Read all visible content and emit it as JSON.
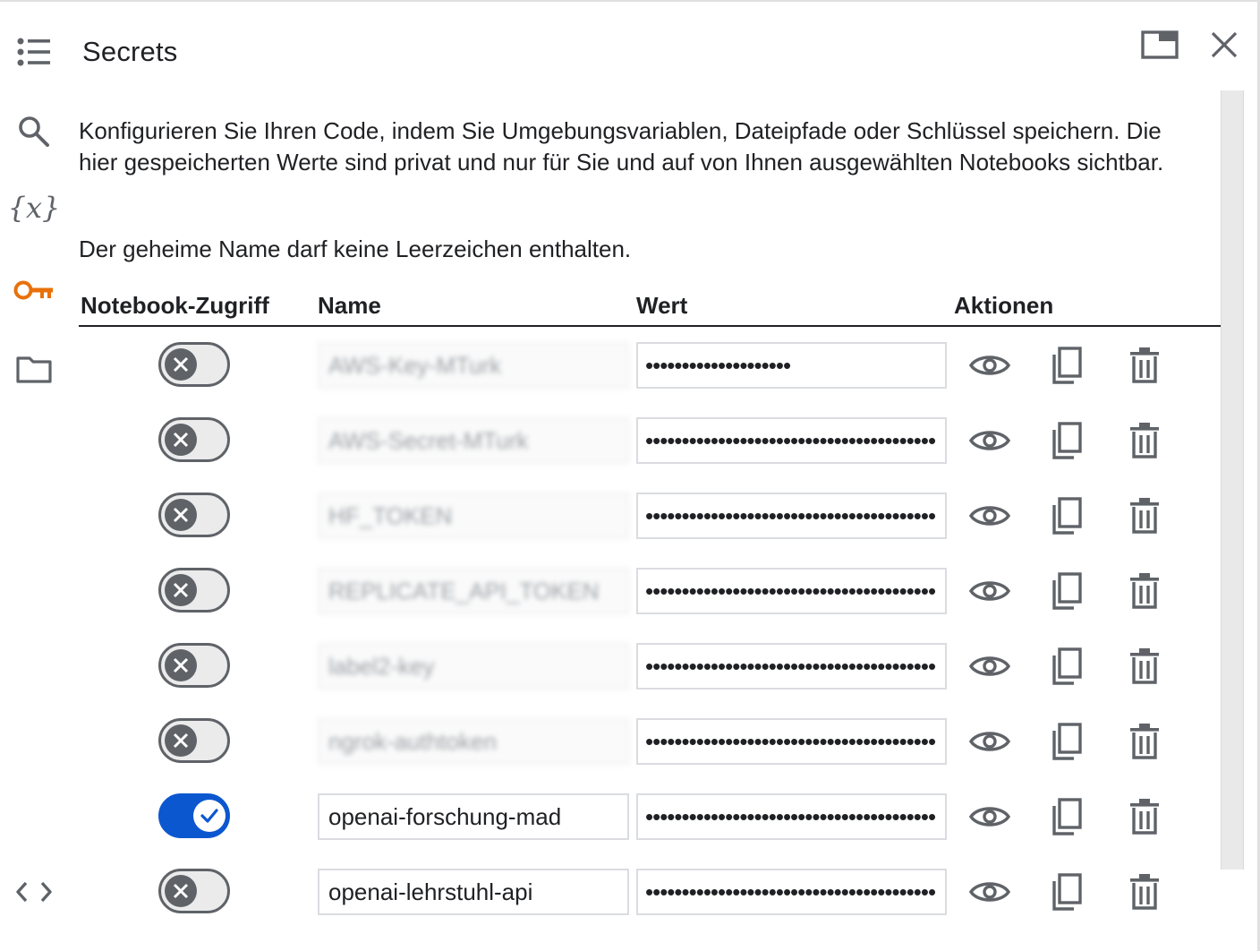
{
  "panel": {
    "title": "Secrets",
    "description": "Konfigurieren Sie Ihren Code, indem Sie Umgebungsvariablen, Dateipfade oder Schlüssel speichern. Die hier gespeicherten Werte sind privat und nur für Sie und auf von Ihnen ausgewählten Notebooks sichtbar.",
    "note": "Der geheime Name darf keine Leerzeichen enthalten."
  },
  "sidebar": {
    "items": [
      {
        "icon": "table-of-contents-icon"
      },
      {
        "icon": "search-icon"
      },
      {
        "icon": "variables-icon",
        "label": "{x}"
      },
      {
        "icon": "key-icon",
        "active": true,
        "color": "#e8710a"
      },
      {
        "icon": "folder-icon"
      },
      {
        "icon": "code-snippets-icon"
      }
    ]
  },
  "header_actions": [
    {
      "icon": "open-in-tab-icon"
    },
    {
      "icon": "close-icon"
    }
  ],
  "table": {
    "columns": [
      "Notebook-Zugriff",
      "Name",
      "Wert",
      "Aktionen"
    ],
    "rows": [
      {
        "access": false,
        "name": "AWS-Key-MTurk",
        "blurred": true,
        "value": "••••••••••••••••••••"
      },
      {
        "access": false,
        "name": "AWS-Secret-MTurk",
        "blurred": true,
        "value": "••••••••••••••••••••••••••••••••••••••••"
      },
      {
        "access": false,
        "name": "HF_TOKEN",
        "blurred": true,
        "value": "••••••••••••••••••••••••••••••••••••••••"
      },
      {
        "access": false,
        "name": "REPLICATE_API_TOKEN",
        "blurred": true,
        "value": "••••••••••••••••••••••••••••••••••••••••"
      },
      {
        "access": false,
        "name": "label2-key",
        "blurred": true,
        "value": "••••••••••••••••••••••••••••••••••••••••"
      },
      {
        "access": false,
        "name": "ngrok-authtoken",
        "blurred": true,
        "value": "••••••••••••••••••••••••••••••••••••••••"
      },
      {
        "access": true,
        "name": "openai-forschung-mad",
        "blurred": false,
        "value": "••••••••••••••••••••••••••••••••••••••••"
      },
      {
        "access": false,
        "name": "openai-lehrstuhl-api",
        "blurred": false,
        "value": "••••••••••••••••••••••••••••••••••••••••"
      }
    ],
    "row_actions": [
      {
        "icon": "eye-icon"
      },
      {
        "icon": "copy-icon"
      },
      {
        "icon": "trash-icon"
      }
    ]
  },
  "colors": {
    "accent": "#0b57d0",
    "active_icon": "#e8710a",
    "icon": "#5f6368"
  }
}
